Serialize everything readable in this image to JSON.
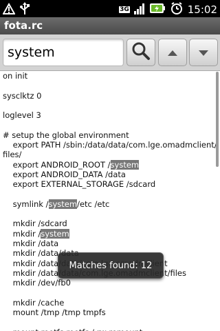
{
  "status_bar": {
    "time": "15:02",
    "network_label": "3G",
    "icons": [
      "usb-debug-icon",
      "usb-icon",
      "signal-icon",
      "battery-icon",
      "alarm-icon"
    ]
  },
  "titlebar": {
    "title": "fota.rc"
  },
  "search": {
    "value": "system",
    "buttons": [
      "search-icon",
      "previous-match-icon",
      "next-match-icon"
    ]
  },
  "file_lines": [
    [
      "on init"
    ],
    [
      ""
    ],
    [
      "sysclktz 0"
    ],
    [
      ""
    ],
    [
      "loglevel 3"
    ],
    [
      ""
    ],
    [
      "# setup the global environment"
    ],
    [
      "    export PATH /sbin:/data/data/com.lge.omadmclient/"
    ],
    [
      "files/"
    ],
    [
      "    export ANDROID_ROOT /",
      "system"
    ],
    [
      "    export ANDROID_DATA /data"
    ],
    [
      "    export EXTERNAL_STORAGE /sdcard"
    ],
    [
      ""
    ],
    [
      "    symlink /",
      "system",
      "/etc /etc"
    ],
    [
      ""
    ],
    [
      "    mkdir /sdcard"
    ],
    [
      "    mkdir /",
      "system"
    ],
    [
      "    mkdir /data"
    ],
    [
      "    mkdir /data/data"
    ],
    [
      "    mkdir /data/data/com.lge.omadmclient"
    ],
    [
      "    mkdir /data/data/com.lge.omadmclient/files"
    ],
    [
      "    mkdir /dev/fb0"
    ],
    [
      ""
    ],
    [
      "    mkdir /cache"
    ],
    [
      "    mount /tmp /tmp tmpfs"
    ],
    [
      ""
    ],
    [
      "    mount rootfs rootfs / rw remount"
    ]
  ],
  "toast": {
    "text": "Matches found: 12"
  }
}
